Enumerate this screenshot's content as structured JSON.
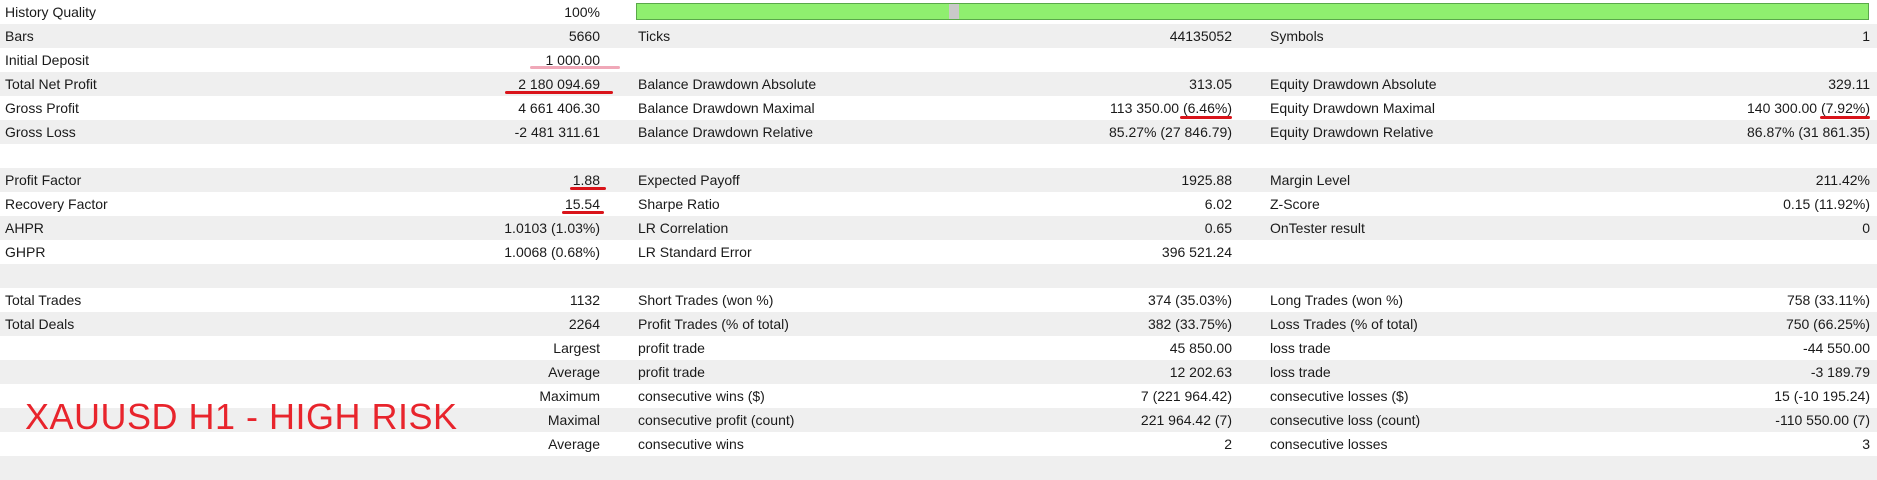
{
  "watermark": "XAUUSD H1 - HIGH RISK",
  "colors": {
    "shade": "#efefef",
    "quality_bar": "#8fef6f",
    "annotation": "#d9141a",
    "watermark": "#e8242c"
  },
  "history_quality": {
    "label": "History Quality",
    "value": "100%",
    "fill_percent": 100
  },
  "rows": [
    {
      "l1": "Bars",
      "v1": "5660",
      "l2": "Ticks",
      "v2": "44135052",
      "l3": "Symbols",
      "v3": "1"
    },
    {
      "l1": "Initial Deposit",
      "v1": "1 000.00",
      "l2": "",
      "v2": "",
      "l3": "",
      "v3": ""
    },
    {
      "l1": "Total Net Profit",
      "v1": "2 180 094.69",
      "l2": "Balance Drawdown Absolute",
      "v2": "313.05",
      "l3": "Equity Drawdown Absolute",
      "v3": "329.11"
    },
    {
      "l1": "Gross Profit",
      "v1": "4 661 406.30",
      "l2": "Balance Drawdown Maximal",
      "v2": "113 350.00 (6.46%)",
      "l3": "Equity Drawdown Maximal",
      "v3": "140 300.00 (7.92%)"
    },
    {
      "l1": "Gross Loss",
      "v1": "-2 481 311.61",
      "l2": "Balance Drawdown Relative",
      "v2": "85.27% (27 846.79)",
      "l3": "Equity Drawdown Relative",
      "v3": "86.87% (31 861.35)"
    },
    {
      "l1": "",
      "v1": "",
      "l2": "",
      "v2": "",
      "l3": "",
      "v3": ""
    },
    {
      "l1": "Profit Factor",
      "v1": "1.88",
      "l2": "Expected Payoff",
      "v2": "1925.88",
      "l3": "Margin Level",
      "v3": "211.42%"
    },
    {
      "l1": "Recovery Factor",
      "v1": "15.54",
      "l2": "Sharpe Ratio",
      "v2": "6.02",
      "l3": "Z-Score",
      "v3": "0.15 (11.92%)"
    },
    {
      "l1": "AHPR",
      "v1": "1.0103 (1.03%)",
      "l2": "LR Correlation",
      "v2": "0.65",
      "l3": "OnTester result",
      "v3": "0"
    },
    {
      "l1": "GHPR",
      "v1": "1.0068 (0.68%)",
      "l2": "LR Standard Error",
      "v2": "396 521.24",
      "l3": "",
      "v3": ""
    },
    {
      "l1": "",
      "v1": "",
      "l2": "",
      "v2": "",
      "l3": "",
      "v3": ""
    },
    {
      "l1": "Total Trades",
      "v1": "1132",
      "l2": "Short Trades (won %)",
      "v2": "374 (35.03%)",
      "l3": "Long Trades (won %)",
      "v3": "758 (33.11%)"
    },
    {
      "l1": "Total Deals",
      "v1": "2264",
      "l2": "Profit Trades (% of total)",
      "v2": "382 (33.75%)",
      "l3": "Loss Trades (% of total)",
      "v3": "750 (66.25%)"
    },
    {
      "l1": "",
      "v1": "Largest",
      "l2": "profit trade",
      "v2": "45 850.00",
      "l3": "loss trade",
      "v3": "-44 550.00"
    },
    {
      "l1": "",
      "v1": "Average",
      "l2": "profit trade",
      "v2": "12 202.63",
      "l3": "loss trade",
      "v3": "-3 189.79"
    },
    {
      "l1": "",
      "v1": "Maximum",
      "l2": "consecutive wins ($)",
      "v2": "7 (221 964.42)",
      "l3": "consecutive losses ($)",
      "v3": "15 (-10 195.24)"
    },
    {
      "l1": "",
      "v1": "Maximal",
      "l2": "consecutive profit (count)",
      "v2": "221 964.42 (7)",
      "l3": "consecutive loss (count)",
      "v3": "-110 550.00 (7)"
    },
    {
      "l1": "",
      "v1": "Average",
      "l2": "consecutive wins",
      "v2": "2",
      "l3": "consecutive losses",
      "v3": "3"
    },
    {
      "l1": "",
      "v1": "",
      "l2": "",
      "v2": "",
      "l3": "",
      "v3": ""
    }
  ]
}
